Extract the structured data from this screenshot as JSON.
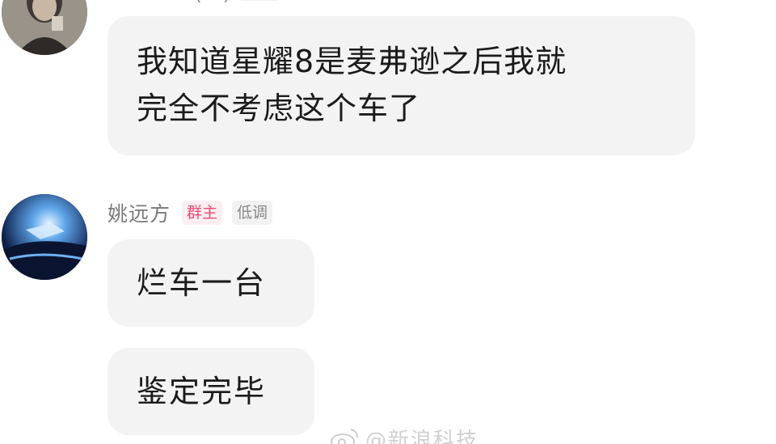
{
  "messages": [
    {
      "sender_name": "?????? (??)",
      "text_line1": "我知道星耀8是麦弗逊之后我就",
      "text_line2": "完全不考虑这个车了"
    },
    {
      "sender_name": "姚远方",
      "badge_role": "群主",
      "badge_level": "低调",
      "bubbles": [
        "烂车一台",
        "鉴定完毕"
      ]
    }
  ],
  "watermark": {
    "text": "@新浪科技",
    "icon": "weibo-logo-icon"
  },
  "colors": {
    "bubble_bg": "#f3f3f3",
    "owner_badge_text": "#e54e76",
    "owner_badge_bg": "#fdeef2",
    "level_badge_bg": "#f2f2f2",
    "name_text": "#7a7a7a"
  }
}
